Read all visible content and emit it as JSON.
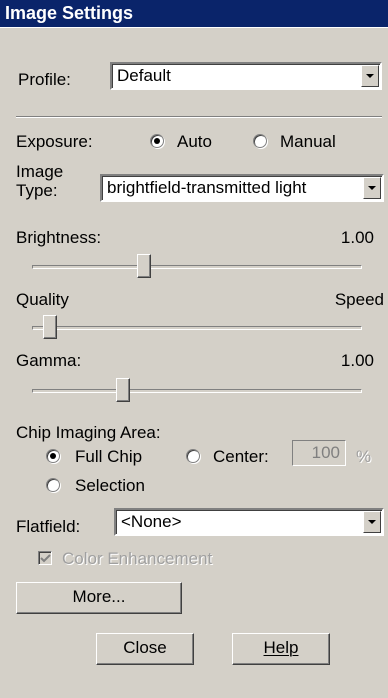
{
  "window": {
    "title": "Image Settings"
  },
  "profile": {
    "label": "Profile:",
    "value": "Default"
  },
  "exposure": {
    "label": "Exposure:",
    "options": [
      {
        "label": "Auto",
        "selected": true
      },
      {
        "label": "Manual",
        "selected": false
      }
    ]
  },
  "image_type": {
    "label_line1": "Image",
    "label_line2": "Type:",
    "value": "brightfield-transmitted light"
  },
  "brightness": {
    "label": "Brightness:",
    "value": "1.00",
    "slider_fraction": 0.33
  },
  "quality_speed": {
    "left_label": "Quality",
    "right_label": "Speed",
    "slider_fraction": 0.0
  },
  "gamma": {
    "label": "Gamma:",
    "value": "1.00",
    "slider_fraction": 0.25
  },
  "chip_area": {
    "label": "Chip Imaging Area:",
    "full_chip": {
      "label": "Full Chip",
      "selected": true
    },
    "center": {
      "label": "Center:",
      "selected": false,
      "value": "100",
      "unit": "%"
    },
    "selection": {
      "label": "Selection",
      "selected": false
    }
  },
  "flatfield": {
    "label": "Flatfield:",
    "value": "<None>"
  },
  "color_enhancement": {
    "label": "Color Enhancement",
    "checked": true,
    "enabled": false
  },
  "buttons": {
    "more": "More...",
    "close": "Close",
    "help": "Help"
  },
  "colors": {
    "titlebar": "#0a246a",
    "face": "#d4d0c8"
  }
}
